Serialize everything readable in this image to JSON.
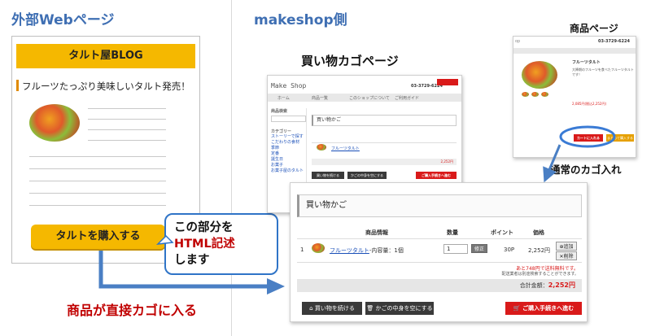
{
  "left_section": {
    "title": "外部Webページ",
    "blog_title": "タルト屋BLOG",
    "post_title": "フルーツたっぷり美味しいタルト発売！",
    "buy_button": "タルトを購入する",
    "callout_line1": "この部分を",
    "callout_line2": "HTML記述",
    "callout_line3": "します",
    "direct_caption": "商品が直接カゴに入る"
  },
  "right_section": {
    "title": "makeshop側",
    "cart_page_caption": "買い物カゴページ",
    "product_page_caption": "商品ページ",
    "normal_cart_caption": "通常のカゴ入れ"
  },
  "small_cart": {
    "logo": "Make Shop",
    "phone": "03-3729-6224",
    "nav": [
      "ホーム",
      "商品一覧",
      "このショップについて",
      "ご利用ガイド"
    ],
    "title": "買い物かご",
    "side_heading1": "商品検索",
    "side_heading2": "カテゴリー",
    "side_links": [
      "ストーリーで探す",
      "こだわりの食材",
      "季節",
      "定番",
      "誕生日",
      "お菓子",
      "お菓子屋のタルト"
    ],
    "item_link": "フルーツタルト",
    "continue_button": "買い物を続ける",
    "empty_button": "かごの中身を空にする",
    "checkout_button": "ご購入手続きへ進む",
    "total": "2,252円"
  },
  "product_page": {
    "phone": "03-3729-6224",
    "product_name": "フルーツタルト",
    "description": "大降期のフルーツを食べたフルーツタルトです！",
    "price": "2,085円(税込2,252円)",
    "cart_button": "カートに入れる",
    "other_button": "まとめて購入する"
  },
  "cart": {
    "title": "買い物かご",
    "headers": {
      "info": "商品情報",
      "qty": "数量",
      "point": "ポイント",
      "price": "価格"
    },
    "row": {
      "num": "1",
      "name": "フルーツタルト",
      "option": "-内容量：1個",
      "qty": "1",
      "update": "修正",
      "point": "30P",
      "price": "2,252円",
      "add": "追加",
      "delete": "削除"
    },
    "free_shipping_note": "あと748円で送料無料です。",
    "delivery_note": "配送業者は別途検索することができます。",
    "total_label": "合計金額：",
    "total_value": "2,252円",
    "continue_button": "買い物を続ける",
    "empty_button": "かごの中身を空にする",
    "checkout_button": "ご購入手続きへ進む"
  },
  "colors": {
    "accent_blue": "#2f74c7",
    "red": "#c00000",
    "yellow": "#f5b800"
  }
}
